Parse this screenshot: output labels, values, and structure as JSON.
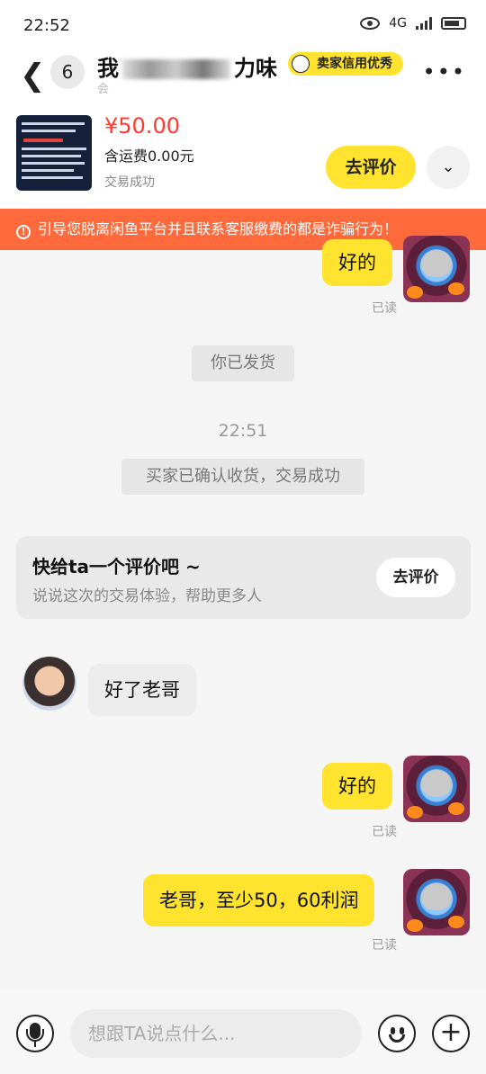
{
  "status": {
    "time": "22:52",
    "network": "4G"
  },
  "header": {
    "unread_count": "6",
    "title_start": "我",
    "title_end": "力味",
    "subtitle": "会",
    "credit_badge": "卖家信用优秀"
  },
  "product": {
    "price": "¥50.00",
    "shipping": "含运费0.00元",
    "deal_status": "交易成功",
    "rate_button": "去评价"
  },
  "warning": {
    "text": "引导您脱离闲鱼平台并且联系客服缴费的都是诈骗行为！"
  },
  "messages": {
    "m1": {
      "text": "好的",
      "read": "已读"
    },
    "shipped": "你已发货",
    "timestamp": "22:51",
    "confirmed": "买家已确认收货，交易成功",
    "other1": "好了老哥",
    "m2": {
      "text": "好的",
      "read": "已读"
    },
    "m3": {
      "text": "老哥，至少50，60利润",
      "read": "已读"
    }
  },
  "review_card": {
    "heading": "快给ta一个评价吧 ~",
    "subtext": "说说这次的交易体验，帮助更多人",
    "button": "去评价"
  },
  "composer": {
    "placeholder": "想跟TA说点什么..."
  },
  "icons": [
    "eye-icon",
    "signal-icon",
    "battery-icon",
    "back-icon",
    "more-icon",
    "chevron-down-icon",
    "alert-icon",
    "mic-icon",
    "emoji-icon",
    "plus-icon"
  ],
  "colors": {
    "accent_yellow": "#ffe32f",
    "warning_orange": "#ff6a3d",
    "price_red": "#ff3b30"
  }
}
